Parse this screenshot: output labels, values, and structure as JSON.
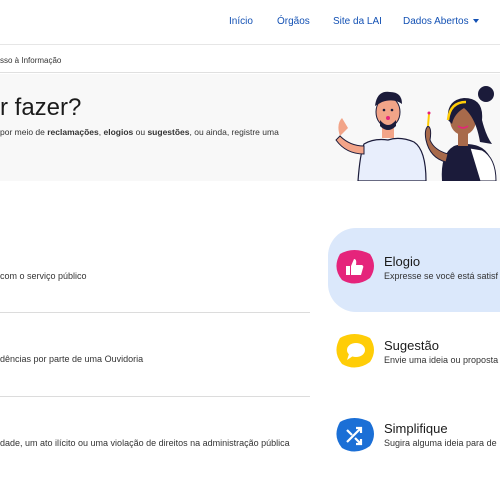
{
  "nav": {
    "links": [
      "Início",
      "Órgãos",
      "Site da LAI",
      "Dados Abertos"
    ]
  },
  "breadcrumb": "sso à Informação",
  "hero": {
    "title": "r fazer?",
    "desc_prefix": "por meio de ",
    "kw1": "reclamações",
    "sep1": ", ",
    "kw2": "elogios",
    "sep2": " ou ",
    "kw3": "sugestões",
    "desc_suffix": ", ou ainda, registre uma"
  },
  "rows": [
    "com o serviço público",
    "dências por parte de uma Ouvidoria",
    "dade, um ato ilícito ou uma violação de direitos na administração pública"
  ],
  "cards": [
    {
      "title": "Elogio",
      "desc": "Expresse se você está satisf",
      "icon": "thumbs-up-icon",
      "color": "#e5247b"
    },
    {
      "title": "Sugestão",
      "desc": "Envie uma ideia ou proposta",
      "icon": "chat-bubble-icon",
      "color": "#ffcd07"
    },
    {
      "title": "Simplifique",
      "desc": "Sugira alguma ideia para de",
      "icon": "shuffle-arrows-icon",
      "color": "#1b6fd6"
    }
  ],
  "colors": {
    "link": "#1351b4",
    "highlight_bg": "#dbe8fb",
    "hero_bg": "#f8f8f8"
  }
}
